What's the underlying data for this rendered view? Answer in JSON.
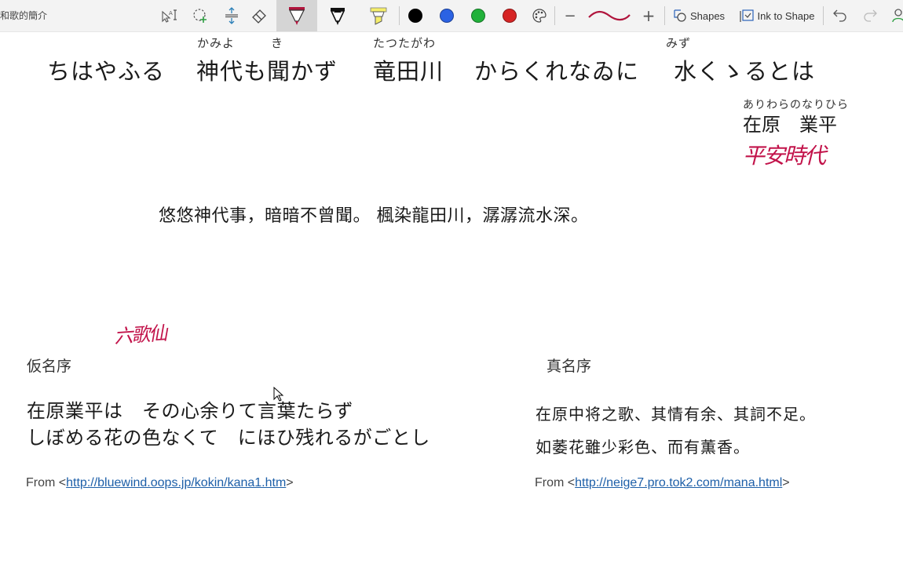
{
  "toolbar": {
    "page_title": "和歌的簡介",
    "tools": [
      {
        "name": "ink-to-text",
        "icon": "select-text-icon"
      },
      {
        "name": "lasso-select",
        "icon": "lasso-icon"
      },
      {
        "name": "add-space",
        "icon": "insert-space-icon"
      },
      {
        "name": "eraser",
        "icon": "eraser-icon"
      },
      {
        "name": "pen-red",
        "icon": "pen-icon",
        "color": "#b0143c",
        "active": true
      },
      {
        "name": "pen-black",
        "icon": "pen-icon",
        "color": "#000000"
      },
      {
        "name": "highlighter-yellow",
        "icon": "highlighter-icon",
        "color": "#f5ee6a"
      }
    ],
    "colors": [
      "#000000",
      "#2b62e3",
      "#21b13a",
      "#d62424"
    ],
    "thickness_minus": "−",
    "thickness_plus": "+",
    "stroke_color": "#b0143c",
    "shapes_label": "Shapes",
    "ink_to_shape_label": "Ink to Shape"
  },
  "poem": {
    "line1": "ちはやふる",
    "line2": "神代も聞かず",
    "line2_ruby_a": "かみよ",
    "line2_ruby_b": "き",
    "line3": "竜田川",
    "line3_ruby": "たつたがわ",
    "line4": "からくれなゐに",
    "line5": "水くゝるとは",
    "line5_ruby": "みず"
  },
  "author": {
    "ruby": "ありわらのなりひら",
    "name": "在原　業平",
    "ink_note": "平安時代"
  },
  "translation": "悠悠神代事，暗暗不曾聞。 楓染龍田川，潺潺流水深。",
  "ink_note_2": "六歌仙",
  "kana_preface": {
    "heading": "仮名序",
    "line1": "在原業平は　その心余りて言葉たらず",
    "line2": "しぼめる花の色なくて　にほひ残れるがごとし",
    "source_prefix": "From <",
    "source_link": "http://bluewind.oops.jp/kokin/kana1.htm",
    "source_suffix": ">"
  },
  "mana_preface": {
    "heading": "真名序",
    "line1": "在原中将之歌、其情有余、其詞不足。",
    "line2": "如萎花雖少彩色、而有薫香。",
    "source_prefix": "From <",
    "source_link": "http://neige7.pro.tok2.com/mana.html",
    "source_suffix": ">"
  }
}
